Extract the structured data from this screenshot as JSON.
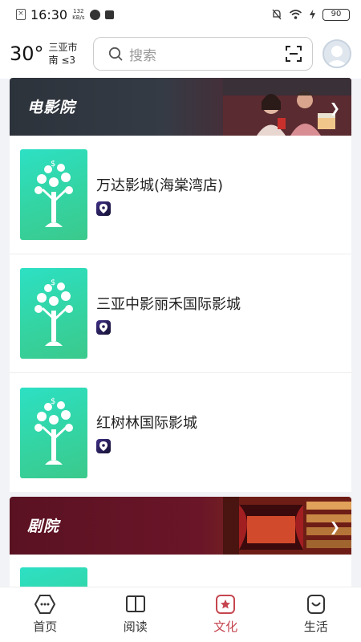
{
  "status_bar": {
    "time": "16:30",
    "net_speed_value": "132",
    "net_speed_unit": "KB/s",
    "battery": "90"
  },
  "header": {
    "temperature": "30°",
    "city": "三亚市",
    "wind": "南  ≤3",
    "search_placeholder": "搜索"
  },
  "sections": [
    {
      "title": "电影院",
      "venues": [
        {
          "name": "万达影城(海棠湾店)"
        },
        {
          "name": "三亚中影丽禾国际影城"
        },
        {
          "name": "红树林国际影城"
        }
      ]
    },
    {
      "title": "剧院",
      "venues": []
    }
  ],
  "bottom_nav": [
    {
      "label": "首页",
      "icon": "home-icon",
      "active": false
    },
    {
      "label": "阅读",
      "icon": "book-icon",
      "active": false
    },
    {
      "label": "文化",
      "icon": "culture-icon",
      "active": true
    },
    {
      "label": "生活",
      "icon": "life-icon",
      "active": false
    }
  ],
  "colors": {
    "active_tab": "#c5454f",
    "thumb_green": "#33d5a5"
  }
}
